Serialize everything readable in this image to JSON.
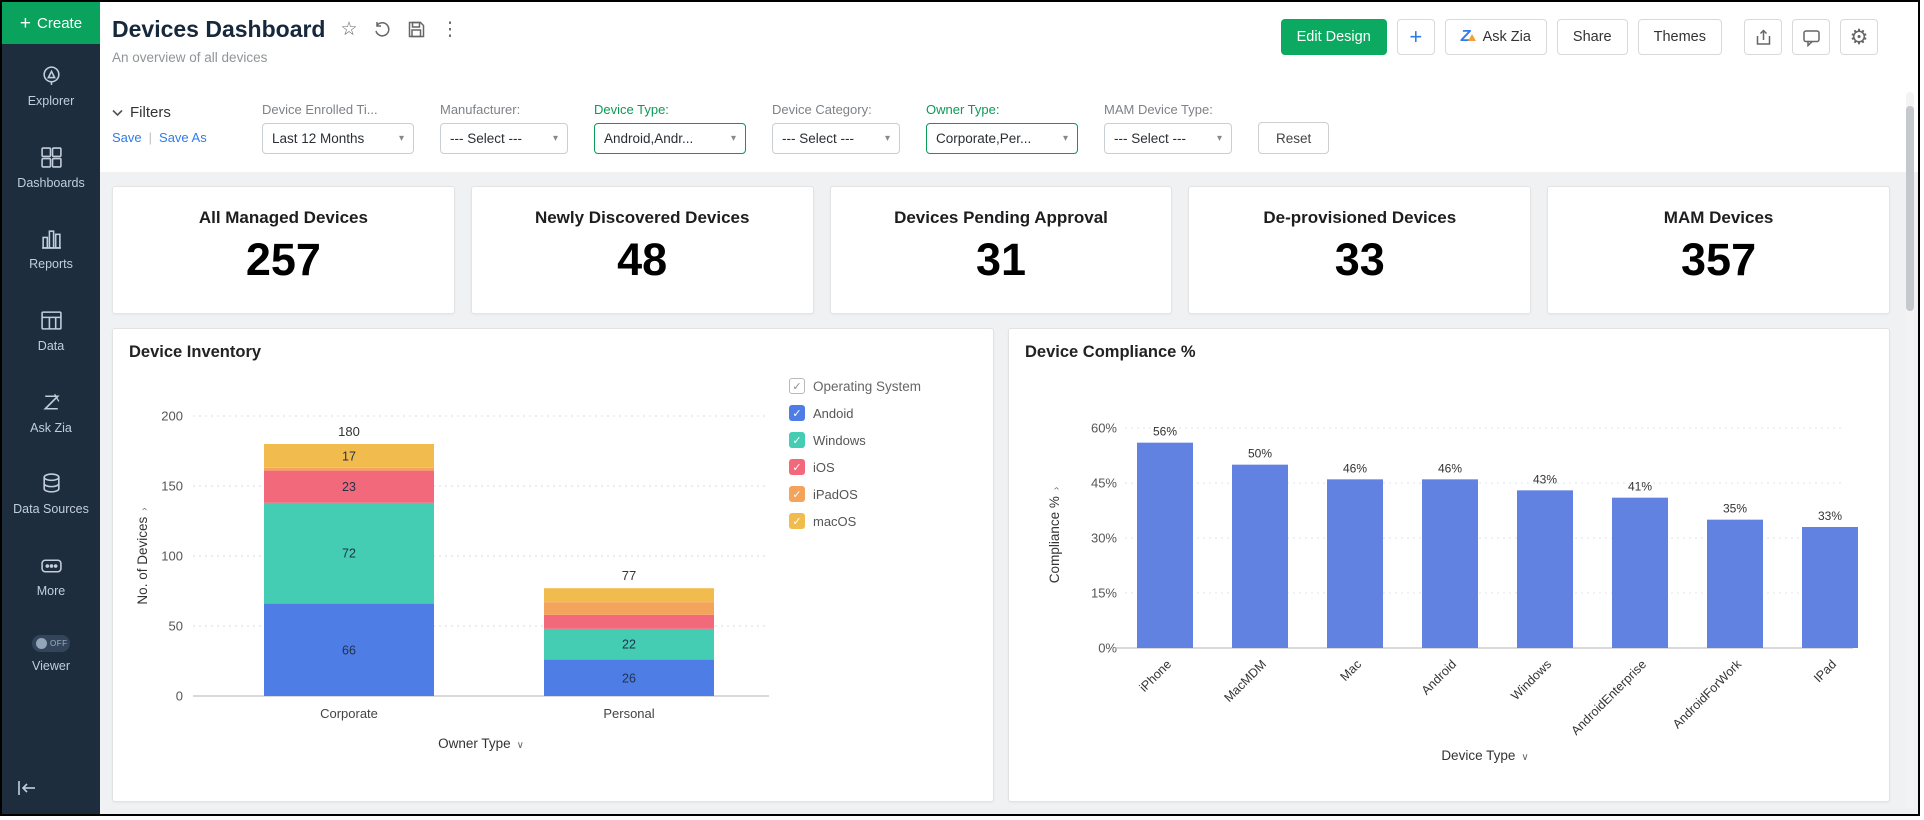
{
  "icons": {
    "plus": "+",
    "kebab": "⋮",
    "star": "☆",
    "gear": "⚙",
    "caret": "▾",
    "check": "✓",
    "pipe": "|",
    "chevron_small": "∨",
    "chevron_side": "›"
  },
  "sidebar": {
    "create_label": "Create",
    "viewer_toggle": "OFF",
    "items": [
      {
        "label": "Explorer"
      },
      {
        "label": "Dashboards"
      },
      {
        "label": "Reports"
      },
      {
        "label": "Data"
      },
      {
        "label": "Ask Zia"
      },
      {
        "label": "Data Sources"
      },
      {
        "label": "More"
      },
      {
        "label": "Viewer"
      }
    ]
  },
  "header": {
    "title": "Devices Dashboard",
    "subtitle": "An overview of all devices",
    "buttons": {
      "edit_design": "Edit Design",
      "plus": "+",
      "ask_zia": "Ask Zia",
      "share": "Share",
      "themes": "Themes"
    }
  },
  "filters": {
    "title": "Filters",
    "save": "Save",
    "save_as": "Save As",
    "reset": "Reset",
    "fields": [
      {
        "label": "Device Enrolled Ti...",
        "value": "Last 12 Months",
        "active": false
      },
      {
        "label": "Manufacturer:",
        "value": "--- Select ---",
        "active": false
      },
      {
        "label": "Device Type:",
        "value": "Android,Andr...",
        "active": true
      },
      {
        "label": "Device Category:",
        "value": "--- Select ---",
        "active": false
      },
      {
        "label": "Owner Type:",
        "value": "Corporate,Per...",
        "active": true
      },
      {
        "label": "MAM Device Type:",
        "value": "--- Select ---",
        "active": false
      }
    ]
  },
  "kpis": [
    {
      "label": "All Managed Devices",
      "value": "257"
    },
    {
      "label": "Newly Discovered Devices",
      "value": "48"
    },
    {
      "label": "Devices Pending Approval",
      "value": "31"
    },
    {
      "label": "De-provisioned Devices",
      "value": "33"
    },
    {
      "label": "MAM Devices",
      "value": "357"
    }
  ],
  "chart_data": [
    {
      "type": "bar",
      "stacked": true,
      "title": "Device Inventory",
      "categories": [
        "Corporate",
        "Personal"
      ],
      "series": [
        {
          "name": "Andoid",
          "color": "#4e7de6",
          "values": [
            66,
            26
          ]
        },
        {
          "name": "Windows",
          "color": "#44cdb3",
          "values": [
            72,
            22
          ]
        },
        {
          "name": "iOS",
          "color": "#f2697c",
          "values": [
            23,
            10
          ]
        },
        {
          "name": "iPadOS",
          "color": "#f4a35b",
          "values": [
            2,
            9
          ]
        },
        {
          "name": "macOS",
          "color": "#f2bb4e",
          "values": [
            17,
            10
          ]
        }
      ],
      "totals": [
        180,
        77
      ],
      "xlabel": "Owner Type",
      "ylabel": "No. of Devices",
      "ylim": [
        0,
        200
      ],
      "yticks": [
        0,
        50,
        100,
        150,
        200
      ],
      "legend_title": "Operating System",
      "label_min_value": 15,
      "grid": "dotted",
      "legend_position": "right"
    },
    {
      "type": "bar",
      "title": "Device Compliance %",
      "categories": [
        "iPhone",
        "MacMDM",
        "Mac",
        "Android",
        "Windows",
        "AndroidEnterprise",
        "AndroidForWork",
        "IPad"
      ],
      "values": [
        56,
        50,
        46,
        46,
        43,
        41,
        35,
        33
      ],
      "labels": [
        "56%",
        "50%",
        "46%",
        "46%",
        "43%",
        "41%",
        "35%",
        "33%"
      ],
      "color": "#6282e2",
      "xlabel": "Device Type",
      "ylabel": "Compliance %",
      "ylim": [
        0,
        60
      ],
      "yticks": [
        "0%",
        "15%",
        "30%",
        "45%",
        "60%"
      ],
      "ytick_values": [
        0,
        15,
        30,
        45,
        60
      ],
      "grid": "dotted"
    }
  ]
}
